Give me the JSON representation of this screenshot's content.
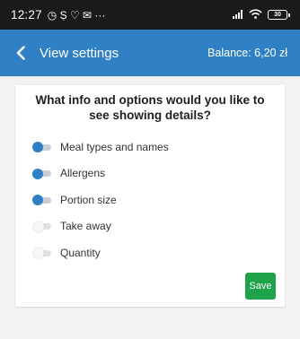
{
  "status_bar": {
    "time": "12:27",
    "notification_glyphs": "◷ Ṣ ♡ ✉ ···",
    "battery": "30"
  },
  "header": {
    "title": "View settings",
    "balance": "Balance: 6,20 zł"
  },
  "settings": {
    "question": "What info and options would you like to see showing details?",
    "options": [
      {
        "label": "Meal types and names",
        "enabled": true
      },
      {
        "label": "Allergens",
        "enabled": true
      },
      {
        "label": "Portion size",
        "enabled": true
      },
      {
        "label": "Take away",
        "enabled": false
      },
      {
        "label": "Quantity",
        "enabled": false
      }
    ],
    "save_label": "Save"
  },
  "colors": {
    "accent": "#2f80c5",
    "save": "#1ea34a",
    "status_bar": "#1a1a1a"
  }
}
